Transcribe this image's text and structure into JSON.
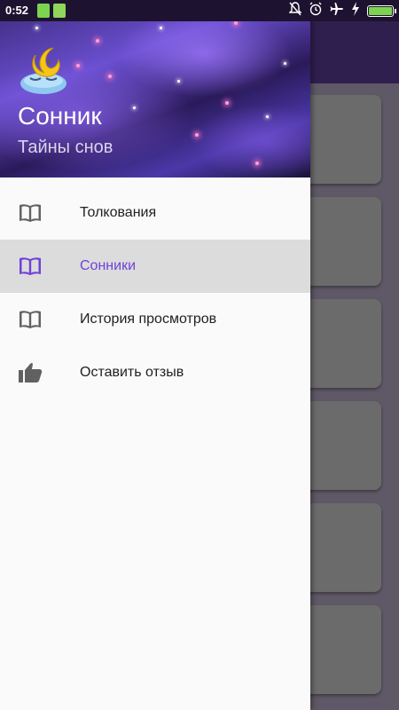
{
  "status_bar": {
    "time": "0:52",
    "battery_level": 1.0,
    "icons": [
      "battery-indicator-icon",
      "alarm-app-icon",
      "bell-off-icon",
      "alarm-clock-icon",
      "airplane-icon",
      "charging-icon",
      "battery-icon"
    ]
  },
  "drawer": {
    "title": "Сонник",
    "subtitle": "Тайны снов",
    "items": [
      {
        "label": "Толкования",
        "icon": "book-icon",
        "active": false
      },
      {
        "label": "Сонники",
        "icon": "book-icon",
        "active": true
      },
      {
        "label": "История просмотров",
        "icon": "book-icon",
        "active": false
      },
      {
        "label": "Оставить отзыв",
        "icon": "thumbs-up-icon",
        "active": false
      }
    ]
  },
  "colors": {
    "accent": "#7040d8",
    "toolbar": "#2f1f4f",
    "scrim": "#5f5866",
    "active_row": "#dcdcdc"
  }
}
